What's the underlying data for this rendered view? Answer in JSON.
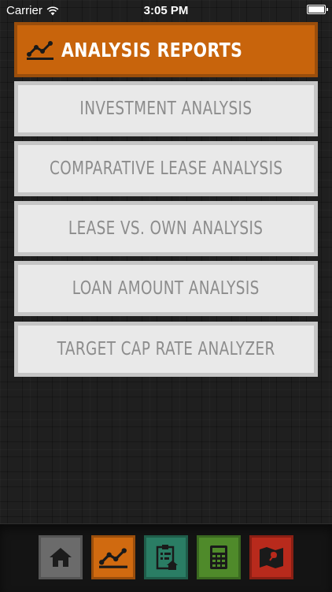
{
  "status_bar": {
    "carrier": "Carrier",
    "time": "3:05 PM"
  },
  "header": {
    "title": "ANALYSIS REPORTS",
    "icon": "chart-line-icon"
  },
  "menu": {
    "items": [
      {
        "label": "INVESTMENT ANALYSIS"
      },
      {
        "label": "COMPARATIVE LEASE ANALYSIS"
      },
      {
        "label": "LEASE VS. OWN ANALYSIS"
      },
      {
        "label": "LOAN AMOUNT ANALYSIS"
      },
      {
        "label": "TARGET CAP RATE ANALYZER"
      }
    ]
  },
  "tab_bar": {
    "tabs": [
      {
        "icon": "home-icon",
        "color": "#6b6b6b",
        "selected": false
      },
      {
        "icon": "chart-line-icon",
        "color": "#d06a10",
        "selected": true
      },
      {
        "icon": "clipboard-home-icon",
        "color": "#2a7d64",
        "selected": false
      },
      {
        "icon": "calculator-icon",
        "color": "#4f8a2a",
        "selected": false
      },
      {
        "icon": "map-pin-icon",
        "color": "#b82a1c",
        "selected": false
      }
    ]
  },
  "colors": {
    "accent": "#c8640c",
    "menu_bg": "#e9e9e9",
    "menu_text": "#8c8c8c",
    "background": "#1f1f1f"
  }
}
